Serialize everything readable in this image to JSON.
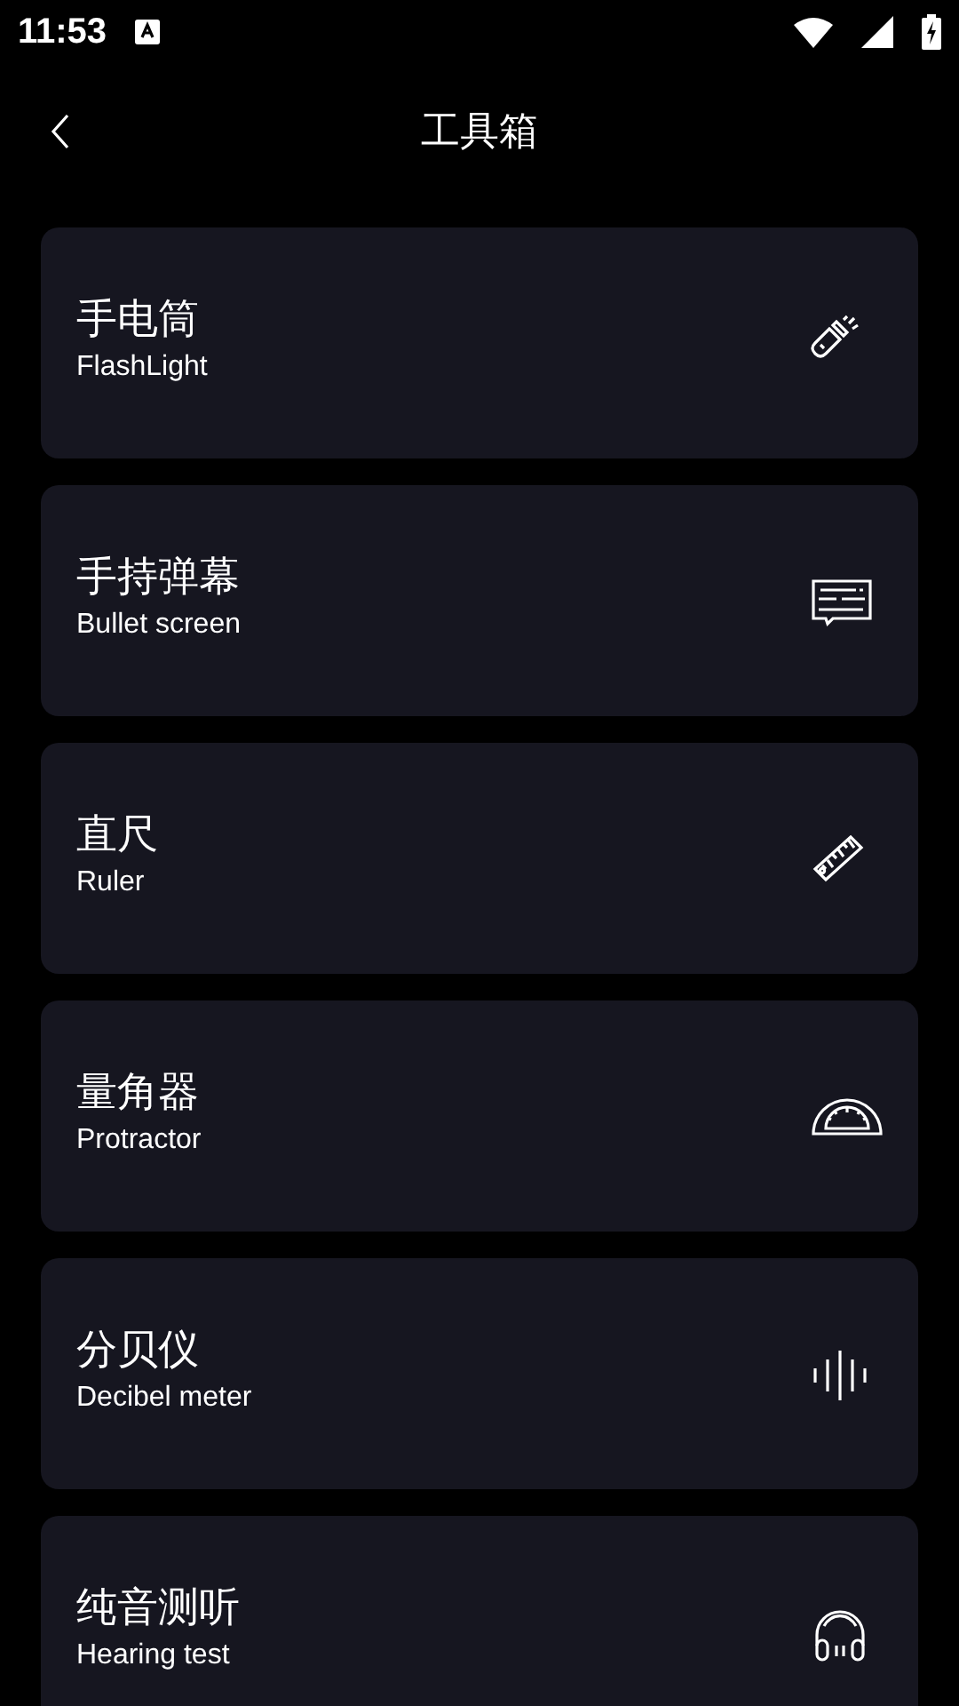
{
  "status_bar": {
    "time": "11:53"
  },
  "header": {
    "title": "工具箱"
  },
  "tools": [
    {
      "title": "手电筒",
      "subtitle": "FlashLight",
      "kind": "flashlight"
    },
    {
      "title": "手持弹幕",
      "subtitle": "Bullet screen",
      "kind": "bullet"
    },
    {
      "title": "直尺",
      "subtitle": "Ruler",
      "kind": "ruler"
    },
    {
      "title": "量角器",
      "subtitle": "Protractor",
      "kind": "protractor"
    },
    {
      "title": "分贝仪",
      "subtitle": "Decibel meter",
      "kind": "decibel"
    },
    {
      "title": "纯音测听",
      "subtitle": "Hearing test",
      "kind": "hearing"
    }
  ]
}
